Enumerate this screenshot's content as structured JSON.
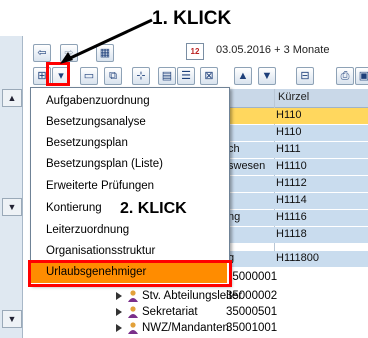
{
  "callouts": {
    "first": "1. KLICK",
    "second": "2. KLICK"
  },
  "header": {
    "date_info": "03.05.2016 + 3 Monate"
  },
  "table": {
    "col_short": "Kürzel",
    "rows": [
      {
        "label": "",
        "code": "H110"
      },
      {
        "label": "",
        "code": "H110"
      },
      {
        "label": "ch",
        "code": "H111"
      },
      {
        "label": "swesen",
        "code": "H1110"
      },
      {
        "label": "",
        "code": "H1112"
      },
      {
        "label": "",
        "code": "H1114"
      },
      {
        "label": "ng",
        "code": "H1116"
      },
      {
        "label": "",
        "code": "H1118"
      },
      {
        "label": "g",
        "code": "H111800"
      }
    ]
  },
  "menu": {
    "items": [
      "Aufgabenzuordnung",
      "Besetzungsanalyse",
      "Besetzungsplan",
      "Besetzungsplan (Liste)",
      "Erweiterte Prüfungen",
      "Kontierung",
      "Leiterzuordnung",
      "Organisationsstruktur",
      "Urlaubsgenehmiger"
    ],
    "highlighted": "Urlaubsgenehmiger"
  },
  "tree": [
    {
      "label": "",
      "code": "35000001"
    },
    {
      "label": "Stv. Abteilungsleiter",
      "code": "35000002"
    },
    {
      "label": "Sekretariat",
      "code": "35000501"
    },
    {
      "label": "NWZ/Mandanten",
      "code": "35001001"
    }
  ],
  "colors": {
    "highlight": "#ff8c00",
    "callout_red": "#ff0000",
    "accent_selected": "#ffd75e"
  }
}
